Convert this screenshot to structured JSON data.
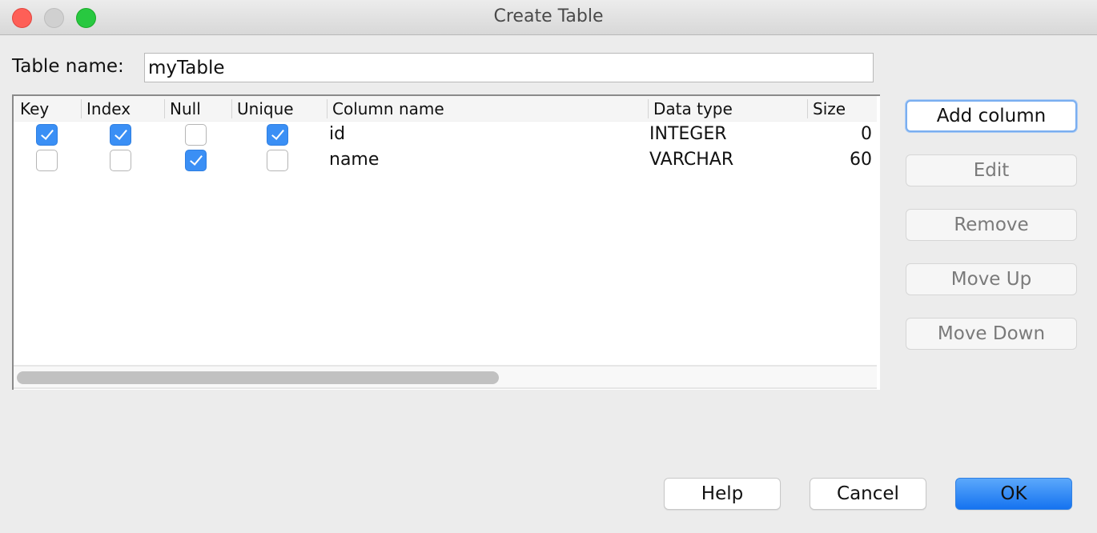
{
  "window": {
    "title": "Create Table",
    "controls": [
      "close",
      "minimize",
      "zoom"
    ]
  },
  "table_name": {
    "label": "Table name:",
    "value": "myTable"
  },
  "columns_table": {
    "headers": [
      "Key",
      "Index",
      "Null",
      "Unique",
      "Column name",
      "Data type",
      "Size"
    ],
    "rows": [
      {
        "key": true,
        "index": true,
        "null": false,
        "unique": true,
        "column_name": "id",
        "data_type": "INTEGER",
        "size": "0"
      },
      {
        "key": false,
        "index": false,
        "null": true,
        "unique": false,
        "column_name": "name",
        "data_type": "VARCHAR",
        "size": "60"
      }
    ]
  },
  "side_buttons": {
    "add_column": "Add column",
    "edit": "Edit",
    "remove": "Remove",
    "move_up": "Move Up",
    "move_down": "Move Down"
  },
  "footer": {
    "help": "Help",
    "cancel": "Cancel",
    "ok": "OK"
  },
  "colors": {
    "accent": "#3a8ff5",
    "ok_button": "#1573f0",
    "close": "#fe5f57",
    "maximize": "#28c840"
  }
}
